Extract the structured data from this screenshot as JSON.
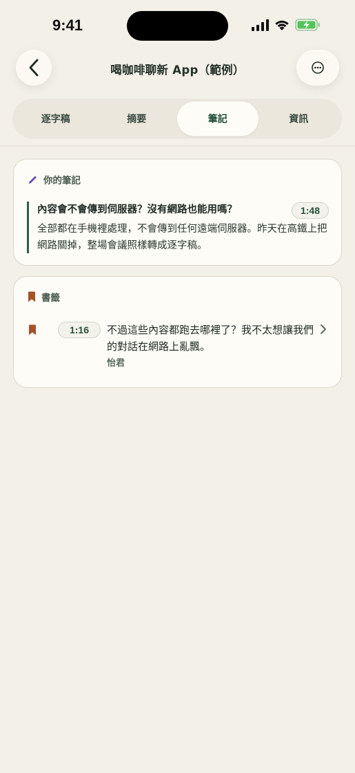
{
  "status_bar": {
    "time": "9:41"
  },
  "header": {
    "title": "喝咖啡聊新 App（範例）"
  },
  "tabs": [
    {
      "label": "逐字稿",
      "active": false
    },
    {
      "label": "摘要",
      "active": false
    },
    {
      "label": "筆記",
      "active": true
    },
    {
      "label": "資訊",
      "active": false
    }
  ],
  "notes": {
    "header": "你的筆記",
    "items": [
      {
        "question": "內容會不會傳到伺服器？沒有網路也能用嗎？",
        "time": "1:48",
        "answer": "全部都在手機裡處理，不會傳到任何遠端伺服器。昨天在高鐵上把網路關掉，整場會議照樣轉成逐字稿。"
      }
    ]
  },
  "bookmarks": {
    "header": "書籤",
    "items": [
      {
        "time": "1:16",
        "text": "不過這些內容都跑去哪裡了？我不太想讓我們的對話在網路上亂飄。",
        "speaker": "怡君"
      }
    ]
  },
  "colors": {
    "background": "#f3f0e8",
    "accent_green": "#1e4d36",
    "pencil_purple": "#6a4bb8",
    "bookmark_brown": "#a4532b",
    "battery_green": "#52c45a"
  }
}
